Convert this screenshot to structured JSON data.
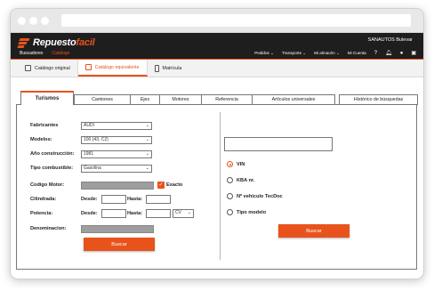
{
  "brand": {
    "part1": "Repuesto",
    "part2": "facil"
  },
  "nav": {
    "left_items": [
      {
        "label": "Buscadores",
        "active": false
      },
      {
        "label": "Catálogo",
        "active": true
      }
    ],
    "account": "SANAUTOS Bulevar",
    "right_items": [
      "Pedidos",
      "Transporte",
      "Mi almacén",
      "Mi Cuenta"
    ]
  },
  "subnav": [
    {
      "label": "Catálogo original",
      "active": false
    },
    {
      "label": "Catálogo equivalente",
      "active": true
    },
    {
      "label": "Matrícula",
      "active": false
    }
  ],
  "tabs": [
    "Turismos",
    "Camiones",
    "Ejes",
    "Motores",
    "Referencia",
    "Artículos universales",
    "Histórico de búsquedas"
  ],
  "form": {
    "fabricantes": {
      "label": "Fabricantes",
      "value": "AUDI"
    },
    "modelos": {
      "label": "Modelos:",
      "value": "100 (43, C2)"
    },
    "anio": {
      "label": "Año construcción:",
      "value": "1981"
    },
    "combustible": {
      "label": "Tipo combustible:",
      "value": "Gasolina"
    },
    "codigo_motor": {
      "label": "Codigo Motor:",
      "exacto": "Exacto"
    },
    "cilindrada": {
      "label": "Cilindrada:",
      "desde": "Desde:",
      "hasta": "Hasta:"
    },
    "potencia": {
      "label": "Potencia:",
      "desde": "Desde:",
      "hasta": "Hasta:",
      "unit": "CV"
    },
    "denominacion": {
      "label": "Denominacion:"
    },
    "buscar": "Buscar"
  },
  "right": {
    "radios": [
      {
        "label": "VIN",
        "checked": true
      },
      {
        "label": "KBA nr.",
        "checked": false
      },
      {
        "label": "Nº vehículo TecDoc",
        "checked": false
      },
      {
        "label": "Tipo modelo",
        "checked": false
      }
    ],
    "buscar": "Buscar"
  },
  "colors": {
    "accent": "#e8531c",
    "nav_bg": "#1e1e1e"
  }
}
